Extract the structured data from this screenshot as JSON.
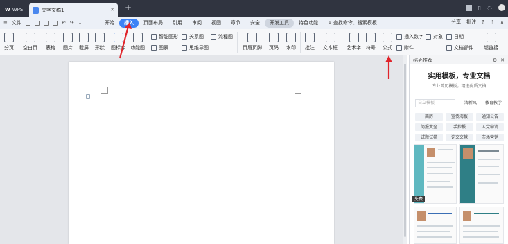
{
  "titlebar": {
    "home_tab": "WPS",
    "doc_tab": "文字文稿1",
    "new_tab_symbol": "+"
  },
  "menubar": {
    "file_label": "文件",
    "tabs": [
      {
        "label": "开始"
      },
      {
        "label": "插入"
      },
      {
        "label": "页面布局"
      },
      {
        "label": "引用"
      },
      {
        "label": "审阅"
      },
      {
        "label": "视图"
      },
      {
        "label": "章节"
      },
      {
        "label": "安全"
      },
      {
        "label": "开发工具"
      },
      {
        "label": "特色功能"
      }
    ],
    "active_tab": "插入",
    "search_label": "查找命令、搜索模板",
    "share_label": "分享",
    "comment_label": "批注"
  },
  "ribbon": {
    "pagination": "分页",
    "blank_page": "空白页",
    "table": "表格",
    "picture": "图片",
    "screenshot": "截屏",
    "shape": "形状",
    "icon_lib": "图标库",
    "function_chart": "功能图",
    "smart_shape": "智能图形",
    "chart": "图表",
    "relation_map": "关系图",
    "flow_chart": "流程图",
    "mind_map": "思维导图",
    "header_footer": "页眉页脚",
    "page_number": "页码",
    "watermark": "水印",
    "comment": "批注",
    "textbox": "文本框",
    "art_text": "艺术字",
    "symbol": "符号",
    "formula": "公式",
    "insert_number": "插入数字",
    "object": "对象",
    "date": "日期",
    "attachment": "附件",
    "doc_part": "文档部件",
    "hyperlink": "超链接"
  },
  "pane": {
    "header": "稻壳推荐",
    "title": "实用模板，专业文档",
    "subtitle": "专业简历模板，精选优质文档",
    "search_placeholder": "自立模板",
    "chips": [
      {
        "label": "清新风"
      },
      {
        "label": "教育教学"
      },
      {
        "label": "简历"
      },
      {
        "label": "宣传海报"
      },
      {
        "label": "通知公告"
      },
      {
        "label": "简报大全"
      },
      {
        "label": "手抄报"
      },
      {
        "label": "入党申请"
      },
      {
        "label": "试题试卷"
      },
      {
        "label": "论文文献"
      },
      {
        "label": "市场营销"
      }
    ],
    "free_badge": "免费"
  },
  "colors": {
    "titlebar": "#303440",
    "active_tab": "#3b82f6",
    "arrow": "#e0242b",
    "resume_accent": "#2f7f86"
  }
}
